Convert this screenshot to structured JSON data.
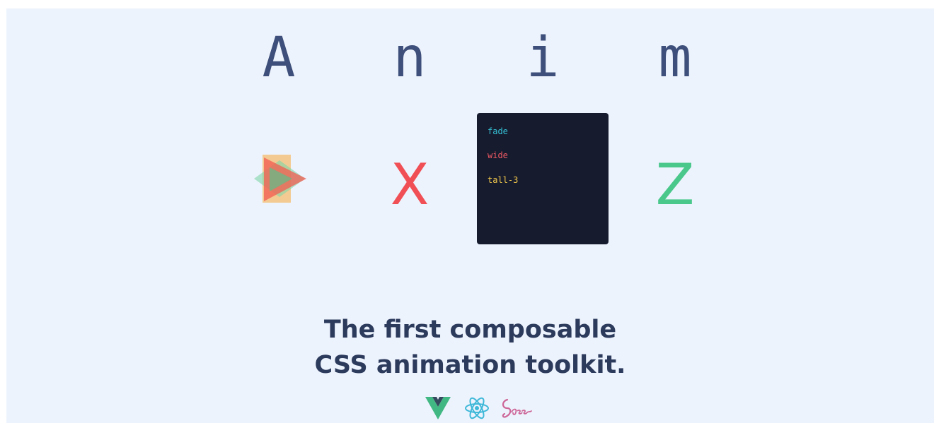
{
  "hero": {
    "letters": [
      "A",
      "n",
      "i",
      "m"
    ],
    "row2": {
      "x_letter": "X",
      "z_letter": "Z"
    },
    "code_panel": {
      "lines": [
        {
          "text": "fade",
          "color": "#35c2d6"
        },
        {
          "text": "wide",
          "color": "#f05a63"
        },
        {
          "text": "tall-3",
          "color": "#f2c94c"
        }
      ]
    },
    "colors": {
      "letter": "#3d4f7a",
      "x_letter": "#f04f55",
      "z_letter": "#4ac88c",
      "background": "#edf3fd"
    }
  },
  "headline": {
    "line1": "The first composable",
    "line2": "CSS animation toolkit."
  },
  "tech_logos": [
    {
      "icon": "vue-logo-icon",
      "color": "#41b883"
    },
    {
      "icon": "react-logo-icon",
      "color": "#61dafb"
    },
    {
      "icon": "sass-logo-icon",
      "color": "#cd6799"
    }
  ]
}
